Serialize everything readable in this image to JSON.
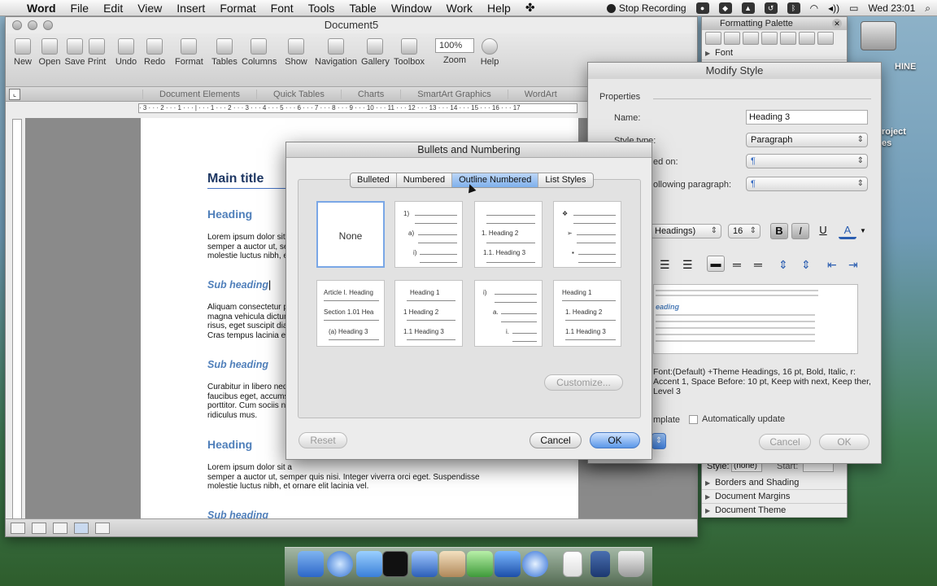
{
  "menubar": {
    "app_name": "Word",
    "items": [
      "File",
      "Edit",
      "View",
      "Insert",
      "Format",
      "Font",
      "Tools",
      "Table",
      "Window",
      "Work",
      "Help"
    ],
    "stop_recording": "Stop Recording",
    "clock": "Wed 23:01"
  },
  "desktop": {
    "hd_label": "HINE",
    "project_label": "roject",
    "project_label2": "es"
  },
  "word": {
    "title": "Document5",
    "toolbar": {
      "new": "New",
      "open": "Open",
      "save": "Save",
      "print": "Print",
      "undo": "Undo",
      "redo": "Redo",
      "format": "Format",
      "tables": "Tables",
      "columns": "Columns",
      "show": "Show",
      "navigation": "Navigation",
      "gallery": "Gallery",
      "toolbox": "Toolbox",
      "zoom": "Zoom",
      "help": "Help",
      "zoom_value": "100%"
    },
    "ribbon": [
      "Document Elements",
      "Quick Tables",
      "Charts",
      "SmartArt Graphics",
      "WordArt"
    ],
    "ruler_ticks": "· 3 · · · 2 · · · 1 · · · | · · · 1 · · · 2 · · · 3 · · · 4 · · · 5 · · · 6 · · · 7 · · · 8 · · · 9 · · · 10 · · · 11 · · · 12 · · · 13 · · · 14 · · · 15 · · · 16 · · · 17",
    "doc": {
      "main_title": "Main title",
      "heading1": "Heading",
      "para1": [
        "Lorem ipsum dolor sit a",
        "semper a auctor ut, se",
        "molestie luctus nibh, et"
      ],
      "sub1": "Sub heading",
      "para2": [
        "Aliquam consectetur po",
        "magna vehicula dictum",
        "risus, eget suscipit diam",
        "Cras tempus lacinia eni"
      ],
      "sub2": "Sub heading",
      "para3": [
        "Curabitur in libero neque",
        "faucibus eget, accumsa",
        "porttitor. Cum sociis nat",
        "ridiculus mus."
      ],
      "heading2": "Heading",
      "para4": [
        "Lorem ipsum dolor sit a",
        "semper a auctor ut, semper quis nisi. Integer viverra orci eget. Suspendisse",
        "molestie luctus nibh, et ornare elit lacinia vel."
      ],
      "sub3": "Sub heading"
    }
  },
  "palette": {
    "title": "Formatting Palette",
    "font_section": "Font",
    "style_label": "Style:",
    "style_value": "(none)",
    "start_label": "Start:",
    "sections": [
      "Borders and Shading",
      "Document Margins",
      "Document Theme"
    ]
  },
  "modify": {
    "title": "Modify Style",
    "properties": "Properties",
    "name_label": "Name:",
    "name_value": "Heading 3",
    "style_type_label": "Style type:",
    "style_type_value": "Paragraph",
    "based_on_label": "ed on:",
    "following_label": "ollowing paragraph:",
    "font_value": "Headings)",
    "size_value": "16",
    "bold": "B",
    "italic": "I",
    "underline": "U",
    "color": "A",
    "preview_heading": "eading",
    "description": "Font:(Default) +Theme Headings, 16 pt, Bold, Italic, r: Accent 1, Space Before:  10 pt, Keep with next, Keep ther, Level 3",
    "add_template": "mplate",
    "auto_update": "Automatically update",
    "cancel": "Cancel",
    "ok": "OK"
  },
  "bullets": {
    "title": "Bullets and Numbering",
    "tabs": [
      "Bulleted",
      "Numbered",
      "Outline Numbered",
      "List Styles"
    ],
    "selected_tab": "Outline Numbered",
    "none_label": "None",
    "g2": [
      "1)",
      "a)",
      "i)"
    ],
    "g3": [
      "1. Heading 2",
      "1.1. Heading 3"
    ],
    "g4": [
      "❖",
      "➢",
      "▪"
    ],
    "g5": [
      "Article I. Heading",
      "Section 1.01 Hea",
      "(a) Heading 3"
    ],
    "g6": [
      "Heading 1",
      "1  Heading 2",
      "1.1  Heading 3"
    ],
    "g7": [
      "i)",
      "a.",
      "i."
    ],
    "g8": [
      "Heading 1",
      "1. Heading 2",
      "1.1 Heading 3"
    ],
    "customize": "Customize...",
    "reset": "Reset",
    "cancel": "Cancel",
    "ok": "OK"
  }
}
